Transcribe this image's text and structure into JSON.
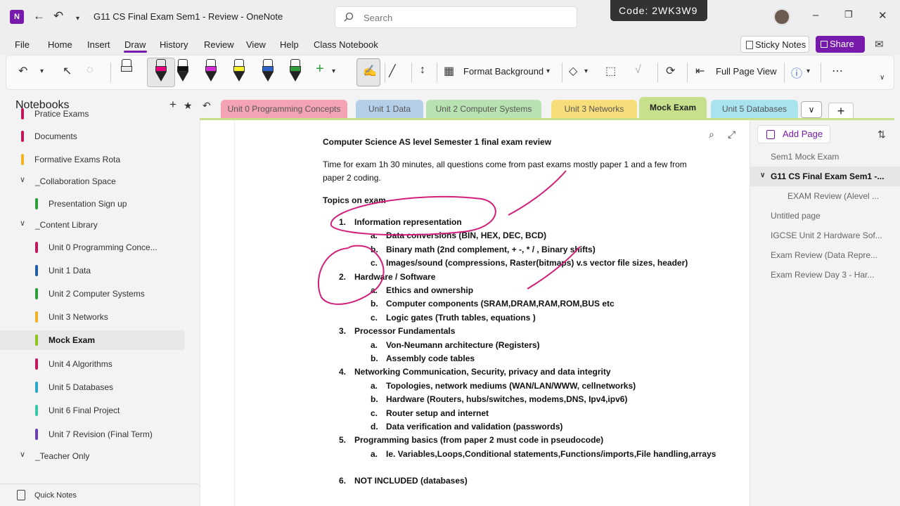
{
  "titlebar": {
    "app_icon_letter": "N",
    "title": "G11 CS Final Exam Sem1 - Review  -  OneNote",
    "search_placeholder": "Search",
    "code": "Code: 2WK3W9"
  },
  "menu": {
    "items": [
      "File",
      "Home",
      "Insert",
      "Draw",
      "History",
      "Review",
      "View",
      "Help",
      "Class Notebook"
    ],
    "active": "Draw",
    "sticky_notes": "Sticky Notes",
    "share": "Share"
  },
  "ribbon": {
    "format_background": "Format Background",
    "full_page_view": "Full Page View",
    "pen_colors": [
      "#e8e8e8",
      "#e6007e",
      "#111111",
      "#d62ad6",
      "#f5ef27",
      "#2e63c9",
      "#2e9e3a"
    ],
    "accent": "#7719aa"
  },
  "notebooks": {
    "title": "Notebooks",
    "sections": [
      {
        "label": "Pratice Exams",
        "color": "#c2185b",
        "indent": 1
      },
      {
        "label": "Documents",
        "color": "#c2185b",
        "indent": 1
      },
      {
        "label": "Formative Exams Rota",
        "color": "#f0b323",
        "indent": 1
      },
      {
        "label": "_Collaboration Space",
        "group": true
      },
      {
        "label": "Presentation Sign up",
        "color": "#2e9e3a",
        "indent": 2
      },
      {
        "label": "_Content Library",
        "group": true
      },
      {
        "label": "Unit 0 Programming Conce...",
        "color": "#c2185b",
        "indent": 2
      },
      {
        "label": "Unit 1 Data",
        "color": "#1f5fa8",
        "indent": 2
      },
      {
        "label": "Unit 2 Computer Systems",
        "color": "#2e9e3a",
        "indent": 2
      },
      {
        "label": "Unit 3 Networks",
        "color": "#f0b323",
        "indent": 2
      },
      {
        "label": "Mock Exam",
        "color": "#8fc31f",
        "indent": 2,
        "active": true
      },
      {
        "label": "Unit 4 Algorithms",
        "color": "#c2185b",
        "indent": 2
      },
      {
        "label": "Unit 5 Databases",
        "color": "#2aa7c9",
        "indent": 2
      },
      {
        "label": "Unit 6 Final Project",
        "color": "#3cc6a8",
        "indent": 2
      },
      {
        "label": "Unit 7 Revision (Final Term)",
        "color": "#6a3fb0",
        "indent": 2
      },
      {
        "label": "_Teacher Only",
        "group": true
      }
    ],
    "quick_notes": "Quick Notes"
  },
  "tabs": [
    {
      "label": "Unit 0 Programming Concepts",
      "bg": "#f4a3b5",
      "fg": "#555"
    },
    {
      "label": "Unit 1 Data",
      "bg": "#b6cfe8",
      "fg": "#555"
    },
    {
      "label": "Unit 2 Computer Systems",
      "bg": "#b9e2b2",
      "fg": "#555"
    },
    {
      "label": "Unit 3 Networks",
      "bg": "#f7de7a",
      "fg": "#555"
    },
    {
      "label": "Mock Exam",
      "bg": "#c7e08c",
      "fg": "#222",
      "active": true
    },
    {
      "label": "Unit 5 Databases",
      "bg": "#a9e3ee",
      "fg": "#555"
    }
  ],
  "page": {
    "heading": "Computer Science AS level Semester 1 final exam review",
    "intro_line1": "Time for exam 1h 30 minutes, all questions come from past exams mostly paper 1 and a few from",
    "intro_line2": "paper 2 coding.",
    "topics_heading": "Topics on exam",
    "topics": [
      {
        "n": "1.",
        "text": "Information representation",
        "subs": [
          {
            "n": "a.",
            "text": "Data conversions (BIN, HEX, DEC, BCD)"
          },
          {
            "n": "b.",
            "text": "Binary math (2nd complement, + -, * / , Binary shifts)"
          },
          {
            "n": "c.",
            "text": "Images/sound (compressions, Raster(bitmaps) v.s vector file sizes, header)"
          }
        ]
      },
      {
        "n": "2.",
        "text": "Hardware / Software",
        "subs": [
          {
            "n": "a.",
            "text": "Ethics and ownership"
          },
          {
            "n": "b.",
            "text": "Computer components (SRAM,DRAM,RAM,ROM,BUS etc"
          },
          {
            "n": "c.",
            "text": "Logic gates (Truth tables, equations )"
          }
        ]
      },
      {
        "n": "3.",
        "text": "Processor Fundamentals",
        "subs": [
          {
            "n": "a.",
            "text": "Von-Neumann architecture (Registers)"
          },
          {
            "n": "b.",
            "text": "Assembly code tables"
          }
        ]
      },
      {
        "n": "4.",
        "text": "Networking Communication, Security, privacy and data integrity",
        "subs": [
          {
            "n": "a.",
            "text": "Topologies, network mediums (WAN/LAN/WWW, cellnetworks)"
          },
          {
            "n": "b.",
            "text": "Hardware (Routers, hubs/switches, modems,DNS, Ipv4,ipv6)"
          },
          {
            "n": "c.",
            "text": "Router setup and internet"
          },
          {
            "n": "d.",
            "text": "Data verification and validation (passwords)"
          }
        ]
      },
      {
        "n": "5.",
        "text": "Programming basics (from paper 2 must code in pseudocode)",
        "subs": [
          {
            "n": "a.",
            "text": "Ie. Variables,Loops,Conditional statements,Functions/imports,File handling,arrays"
          }
        ]
      },
      {
        "n": "6.",
        "text": "NOT INCLUDED (databases)",
        "subs": []
      }
    ],
    "ink_color": "#d0207a"
  },
  "pages_pane": {
    "add_page": "Add Page",
    "pages": [
      {
        "label": "Sem1 Mock Exam",
        "level": 0
      },
      {
        "label": "G11 CS Final Exam Sem1 -...",
        "level": 0,
        "active": true
      },
      {
        "label": "EXAM Review (Alevel ...",
        "level": 1
      },
      {
        "label": "Untitled page",
        "level": 0
      },
      {
        "label": "IGCSE Unit 2 Hardware Sof...",
        "level": 0
      },
      {
        "label": "Exam Review (Data Repre...",
        "level": 0
      },
      {
        "label": "Exam Review Day 3 - Har...",
        "level": 0
      }
    ]
  }
}
